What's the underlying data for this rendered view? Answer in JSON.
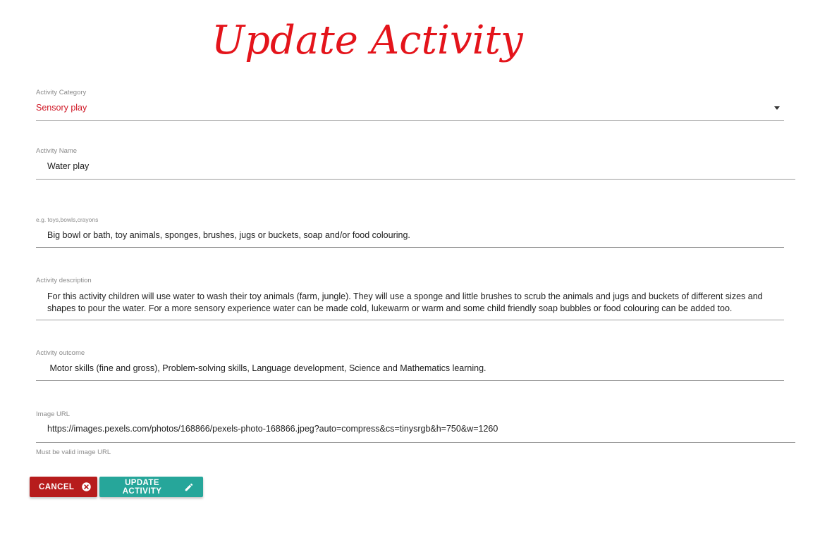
{
  "page": {
    "title": "Update Activity"
  },
  "form": {
    "category": {
      "label": "Activity Category",
      "value": "Sensory play"
    },
    "name": {
      "label": "Activity Name",
      "value": "Water play"
    },
    "materials": {
      "label": "e.g. toys,bowls,crayons",
      "value": "Big bowl or bath, toy animals, sponges, brushes, jugs or buckets, soap and/or food colouring."
    },
    "description": {
      "label": "Activity description",
      "value": "For this activity children will use water to wash their toy animals (farm, jungle). They will use a sponge and little brushes to scrub the animals and jugs and buckets of different sizes and shapes to pour the water. For a more sensory experience water can be made cold, lukewarm or warm and some child friendly soap bubbles or food colouring can be added too."
    },
    "outcome": {
      "label": "Activity outcome",
      "value": " Motor skills (fine and gross), Problem-solving skills, Language development, Science and Mathematics learning."
    },
    "image_url": {
      "label": "Image URL",
      "value": "https://images.pexels.com/photos/168866/pexels-photo-168866.jpeg?auto=compress&cs=tinysrgb&h=750&w=1260",
      "helper": "Must be valid image URL"
    }
  },
  "buttons": {
    "cancel": {
      "label": "Cancel",
      "icon": "cancel-circle-icon",
      "color": "#b71c1c"
    },
    "update": {
      "label": "Update Activity",
      "icon": "pencil-icon",
      "color": "#26a69a"
    }
  },
  "colors": {
    "title": "#e4141b",
    "select_value": "#d01826",
    "label": "#8a8a8a",
    "underline": "#9e9e9e"
  }
}
